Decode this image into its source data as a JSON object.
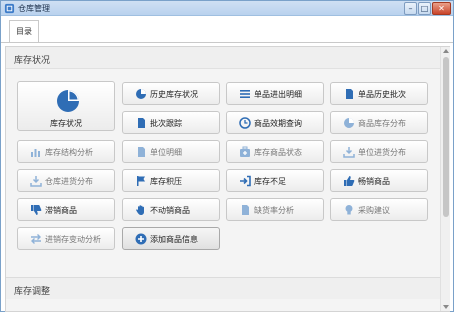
{
  "window": {
    "title": "仓库管理",
    "min": "–",
    "max": "□",
    "close": "✕"
  },
  "tabs": [
    {
      "label": "目录"
    }
  ],
  "sections": {
    "stock_status": {
      "title": "库存状况"
    },
    "stock_adjust": {
      "title": "库存调整"
    }
  },
  "buttons": {
    "stock_status": {
      "label": "库存状况",
      "icon": "pie-chart-icon"
    },
    "history_stock": {
      "label": "历史库存状况",
      "icon": "pie-chart-icon"
    },
    "item_io_detail": {
      "label": "单品进出明细",
      "icon": "list-icon"
    },
    "item_history_batch": {
      "label": "单品历史批次",
      "icon": "document-icon"
    },
    "batch_trace": {
      "label": "批次跟踪",
      "icon": "document-icon"
    },
    "expiry_query": {
      "label": "商品效期查询",
      "icon": "clock-icon"
    },
    "stock_distribution": {
      "label": "商品库存分布",
      "icon": "pie-chart-icon"
    },
    "structure_analysis": {
      "label": "库存结构分析",
      "icon": "bar-chart-icon"
    },
    "unit_detail": {
      "label": "单位明细",
      "icon": "document-icon"
    },
    "stock_item_status": {
      "label": "库存商品状态",
      "icon": "first-aid-icon"
    },
    "unit_inout_dist": {
      "label": "单位进货分布",
      "icon": "download-icon"
    },
    "inout_dist": {
      "label": "仓库进货分布",
      "icon": "download-icon"
    },
    "backlog": {
      "label": "库存积压",
      "icon": "flag-icon"
    },
    "shortage": {
      "label": "库存不足",
      "icon": "login-icon"
    },
    "bestseller": {
      "label": "畅销商品",
      "icon": "thumb-up-icon"
    },
    "slow_seller": {
      "label": "滞销商品",
      "icon": "thumb-down-icon"
    },
    "non_moving": {
      "label": "不动销商品",
      "icon": "hand-icon"
    },
    "out_of_stock_rate": {
      "label": "缺货率分析",
      "icon": "document-icon"
    },
    "purchase_advice": {
      "label": "采购建议",
      "icon": "lightbulb-icon"
    },
    "inout_change_analysis": {
      "label": "进销存变动分析",
      "icon": "exchange-icon"
    },
    "add_product_info": {
      "label": "添加商品信息",
      "icon": "plus-circle-icon"
    }
  }
}
